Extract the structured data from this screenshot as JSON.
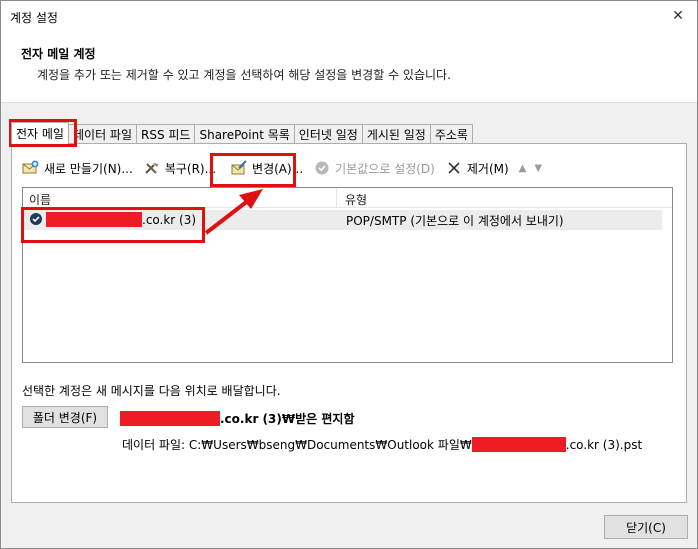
{
  "window": {
    "title": "계정 설정",
    "close_glyph": "✕"
  },
  "header": {
    "title": "전자 메일 계정",
    "description": "계정을 추가 또는 제거할 수 있고 계정을 선택하여 해당 설정을 변경할 수 있습니다."
  },
  "tabs": [
    {
      "label": "전자 메일"
    },
    {
      "label": "데이터 파일"
    },
    {
      "label": "RSS 피드"
    },
    {
      "label": "SharePoint 목록"
    },
    {
      "label": "인터넷 일정"
    },
    {
      "label": "게시된 일정"
    },
    {
      "label": "주소록"
    }
  ],
  "toolbar": {
    "new_label": "새로 만들기(N)...",
    "repair_label": "복구(R)...",
    "change_label": "변경(A)...",
    "set_default_label": "기본값으로 설정(D)",
    "remove_label": "제거(M)",
    "up_glyph": "▲",
    "down_glyph": "▼"
  },
  "accounts_list": {
    "columns": [
      "이름",
      "유형"
    ],
    "rows": [
      {
        "name_suffix": ".co.kr (3)",
        "type": "POP/SMTP (기본으로 이 계정에서 보내기)"
      }
    ]
  },
  "delivery": {
    "text": "선택한 계정은 새 메시지를 다음 위치로 배달합니다.",
    "folder_button": "폴더 변경(F)",
    "folder_path_suffix": ".co.kr (3)₩받은 편지함",
    "datafile_prefix": "데이터 파일: C:₩Users₩bseng₩Documents₩Outlook 파일₩",
    "datafile_suffix": ".co.kr (3).pst"
  },
  "footer": {
    "close_label": "닫기(C)"
  },
  "colors": {
    "highlight": "#e01010",
    "redaction": "#ee1c25"
  }
}
